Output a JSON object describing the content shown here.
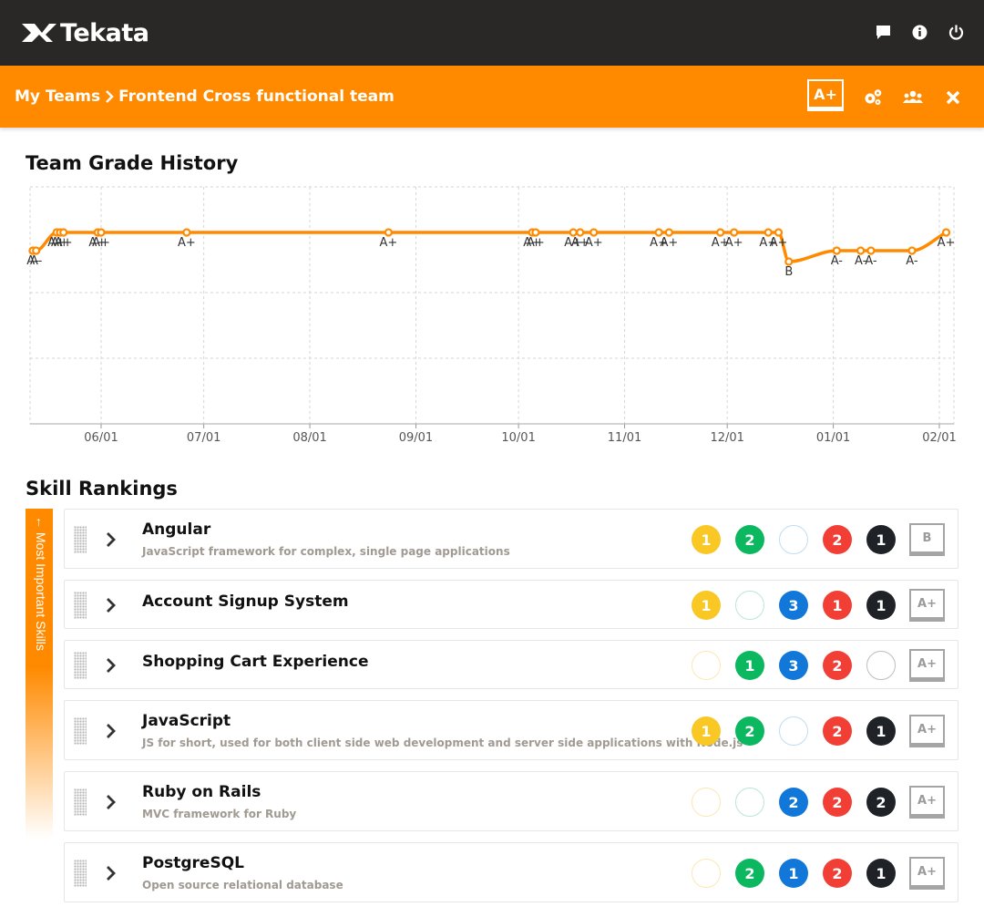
{
  "app": {
    "name": "Tekata"
  },
  "header": {
    "breadcrumb_root": "My Teams",
    "breadcrumb_current": "Frontend Cross functional team",
    "team_grade": "A+"
  },
  "history": {
    "title": "Team Grade History"
  },
  "chart_data": {
    "type": "line",
    "x_ticks": [
      "06/01",
      "07/01",
      "08/01",
      "09/01",
      "10/01",
      "11/01",
      "12/01",
      "01/01",
      "02/01"
    ],
    "y_range_visual": "grade levels (B lowest shown, A+ highest)",
    "grid": true,
    "color": "#ff8a00",
    "points": [
      {
        "date": "05/12",
        "grade": "A-"
      },
      {
        "date": "05/13",
        "grade": "A-"
      },
      {
        "date": "05/19",
        "grade": "A+"
      },
      {
        "date": "05/20",
        "grade": "A+"
      },
      {
        "date": "05/21",
        "grade": "A+"
      },
      {
        "date": "05/31",
        "grade": "A+"
      },
      {
        "date": "06/01",
        "grade": "A+"
      },
      {
        "date": "06/26",
        "grade": "A+"
      },
      {
        "date": "08/24",
        "grade": "A+"
      },
      {
        "date": "10/05",
        "grade": "A+"
      },
      {
        "date": "10/06",
        "grade": "A+"
      },
      {
        "date": "10/17",
        "grade": "A+"
      },
      {
        "date": "10/19",
        "grade": "A+"
      },
      {
        "date": "10/23",
        "grade": "A+"
      },
      {
        "date": "11/11",
        "grade": "A+"
      },
      {
        "date": "11/14",
        "grade": "A+"
      },
      {
        "date": "11/29",
        "grade": "A+"
      },
      {
        "date": "12/03",
        "grade": "A+"
      },
      {
        "date": "12/13",
        "grade": "A+"
      },
      {
        "date": "12/16",
        "grade": "A+"
      },
      {
        "date": "12/19",
        "grade": "B"
      },
      {
        "date": "01/02",
        "grade": "A-"
      },
      {
        "date": "01/09",
        "grade": "A-"
      },
      {
        "date": "01/12",
        "grade": "A-"
      },
      {
        "date": "01/24",
        "grade": "A-"
      },
      {
        "date": "02/03",
        "grade": "A+"
      }
    ]
  },
  "skills_section": {
    "title": "Skill Rankings",
    "side_label": "← Most Important Skills"
  },
  "skills": [
    {
      "name": "Angular",
      "desc": "JavaScript framework for complex, single page applications",
      "grade": "B",
      "levels": [
        {
          "v": "1",
          "c": "yellow"
        },
        {
          "v": "2",
          "c": "green"
        },
        {
          "v": "",
          "c": "blue"
        },
        {
          "v": "2",
          "c": "red"
        },
        {
          "v": "1",
          "c": "dark"
        }
      ]
    },
    {
      "name": "Account Signup System",
      "desc": "",
      "grade": "A+",
      "levels": [
        {
          "v": "1",
          "c": "yellow"
        },
        {
          "v": "",
          "c": "green"
        },
        {
          "v": "3",
          "c": "blue"
        },
        {
          "v": "1",
          "c": "red"
        },
        {
          "v": "1",
          "c": "dark"
        }
      ]
    },
    {
      "name": "Shopping Cart Experience",
      "desc": "",
      "grade": "A+",
      "levels": [
        {
          "v": "",
          "c": "yellow"
        },
        {
          "v": "1",
          "c": "green"
        },
        {
          "v": "3",
          "c": "blue"
        },
        {
          "v": "2",
          "c": "red"
        },
        {
          "v": "",
          "c": "gray"
        }
      ]
    },
    {
      "name": "JavaScript",
      "desc": "JS for short, used for both client side web development and server side applications with Node.js",
      "grade": "A+",
      "levels": [
        {
          "v": "1",
          "c": "yellow"
        },
        {
          "v": "2",
          "c": "green"
        },
        {
          "v": "",
          "c": "blue"
        },
        {
          "v": "2",
          "c": "red"
        },
        {
          "v": "1",
          "c": "dark"
        }
      ]
    },
    {
      "name": "Ruby on Rails",
      "desc": "MVC framework for Ruby",
      "grade": "A+",
      "levels": [
        {
          "v": "",
          "c": "yellow"
        },
        {
          "v": "",
          "c": "green"
        },
        {
          "v": "2",
          "c": "blue"
        },
        {
          "v": "2",
          "c": "red"
        },
        {
          "v": "2",
          "c": "dark"
        }
      ]
    },
    {
      "name": "PostgreSQL",
      "desc": "Open source relational database",
      "grade": "A+",
      "levels": [
        {
          "v": "",
          "c": "yellow"
        },
        {
          "v": "2",
          "c": "green"
        },
        {
          "v": "1",
          "c": "blue"
        },
        {
          "v": "2",
          "c": "red"
        },
        {
          "v": "1",
          "c": "dark"
        }
      ]
    }
  ]
}
